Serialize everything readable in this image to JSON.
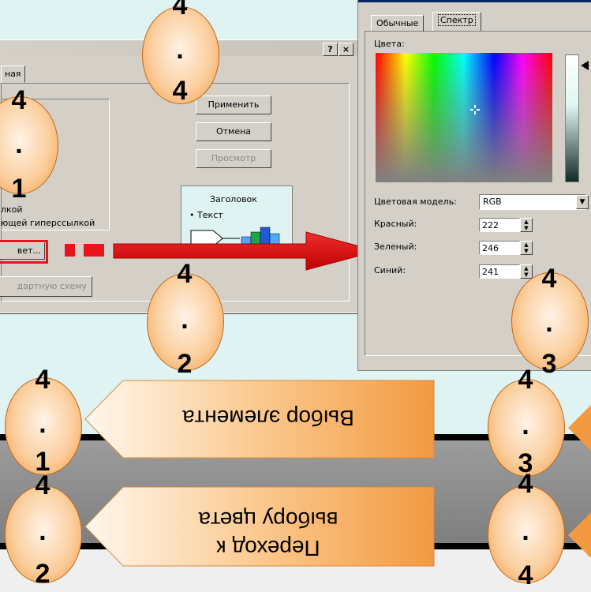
{
  "window_left": {
    "help_button": "?",
    "close_button": "×",
    "tab_fragment": "ная",
    "buttons": {
      "apply": "Применить",
      "cancel": "Отмена",
      "preview": "Просмотр"
    },
    "preview_title": "Заголовок",
    "preview_bullet": "• Текст",
    "link_line_1": "лкой",
    "link_line_2": "ющей гиперссылкой",
    "color_button": "вет...",
    "scheme_button": "дартную схему"
  },
  "window_right": {
    "tabs": [
      "Обычные",
      "Спектр"
    ],
    "colors_label": "Цвета:",
    "color_model_label": "Цветовая модель:",
    "color_model_value": "RGB",
    "red_label": "Красный:",
    "green_label": "Зеленый:",
    "blue_label": "Синий:",
    "red_value": "222",
    "green_value": "246",
    "blue_value": "241"
  },
  "ovals": {
    "o44": [
      "4",
      ".",
      "4"
    ],
    "o41": [
      "4",
      ".",
      "1"
    ],
    "o42": [
      "4",
      ".",
      "2"
    ],
    "o43": [
      "4",
      ".",
      "3"
    ],
    "b41": [
      "4",
      ".",
      "1"
    ],
    "b42": [
      "4",
      ".",
      "2"
    ],
    "b43": [
      "4",
      ".",
      "3"
    ],
    "b44": [
      "4",
      ".",
      "4"
    ]
  },
  "callouts": {
    "select_element": "Выбор элемента",
    "go_to_color_line1": "Переход к",
    "go_to_color_line2": "выбору цвета"
  },
  "colors": {
    "accent_red": "#e8141b",
    "oval_orange": "#f39a40",
    "dialog_gray": "#d4d0c8"
  }
}
